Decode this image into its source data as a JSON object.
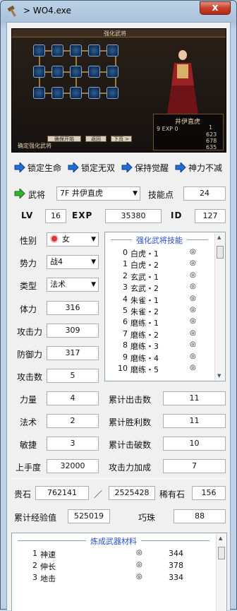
{
  "window": {
    "title": "> WO4.exe",
    "close": "x"
  },
  "banner": {
    "header": "强化武将",
    "hint": "确定强化武将",
    "btn_confirm": "确保开始",
    "btn_back": "返回",
    "btn_next": "下页 >",
    "panel_name": "井伊直虎",
    "panel_exp": "9 EXP 0",
    "stats": [
      "1",
      "623",
      "678",
      "635"
    ]
  },
  "options": [
    "锁定生命",
    "锁定无双",
    "保持觉醒",
    "神力不减"
  ],
  "general": {
    "label": "武将",
    "selected": "7F 井伊直虎"
  },
  "skill_points": {
    "label": "技能点",
    "value": "24"
  },
  "lv": {
    "label": "LV",
    "value": "16"
  },
  "exp": {
    "label": "EXP",
    "value": "35380"
  },
  "id": {
    "label": "ID",
    "value": "127"
  },
  "gender": {
    "label": "性别",
    "value": "女"
  },
  "faction": {
    "label": "势力",
    "value": "战4"
  },
  "type": {
    "label": "类型",
    "value": "法术"
  },
  "hp": {
    "label": "体力",
    "value": "316"
  },
  "attack": {
    "label": "攻击力",
    "value": "309"
  },
  "defense": {
    "label": "防御力",
    "value": "317"
  },
  "attack_count": {
    "label": "攻击数",
    "value": "5"
  },
  "skills": {
    "title": "强化武将技能",
    "mark": "◎",
    "items": [
      {
        "idx": "0",
        "name": "白虎・1"
      },
      {
        "idx": "1",
        "name": "白虎・2"
      },
      {
        "idx": "2",
        "name": "玄武・1"
      },
      {
        "idx": "3",
        "name": "玄武・2"
      },
      {
        "idx": "4",
        "name": "朱雀・1"
      },
      {
        "idx": "5",
        "name": "朱雀・2"
      },
      {
        "idx": "6",
        "name": "磨练・1"
      },
      {
        "idx": "7",
        "name": "磨练・2"
      },
      {
        "idx": "8",
        "name": "磨练・3"
      },
      {
        "idx": "9",
        "name": "磨练・4"
      },
      {
        "idx": "10",
        "name": "磨练・5"
      }
    ]
  },
  "strength": {
    "label": "力量",
    "value": "4"
  },
  "magic": {
    "label": "法术",
    "value": "2"
  },
  "agility": {
    "label": "敏捷",
    "value": "3"
  },
  "skill_level": {
    "label": "上手度",
    "value": "32000"
  },
  "total_sorties": {
    "label": "累计出击数",
    "value": "11"
  },
  "total_wins": {
    "label": "累计胜利数",
    "value": "11"
  },
  "total_kos": {
    "label": "累计击破数",
    "value": "10"
  },
  "attack_bonus": {
    "label": "攻击力加成",
    "value": "7"
  },
  "gems": {
    "label": "贵石",
    "current": "762141",
    "slash": "／",
    "max": "2525428"
  },
  "rare_stone": {
    "label": "稀有石",
    "value": "156"
  },
  "total_exp": {
    "label": "累计经验值",
    "value": "525019"
  },
  "orbs": {
    "label": "巧珠",
    "value": "88"
  },
  "materials": {
    "title": "炼成武器材料",
    "mark": "◎",
    "items": [
      {
        "idx": "1",
        "name": "神速",
        "count": "344"
      },
      {
        "idx": "2",
        "name": "伸长",
        "count": "378"
      },
      {
        "idx": "3",
        "name": "地击",
        "count": "334"
      }
    ]
  }
}
